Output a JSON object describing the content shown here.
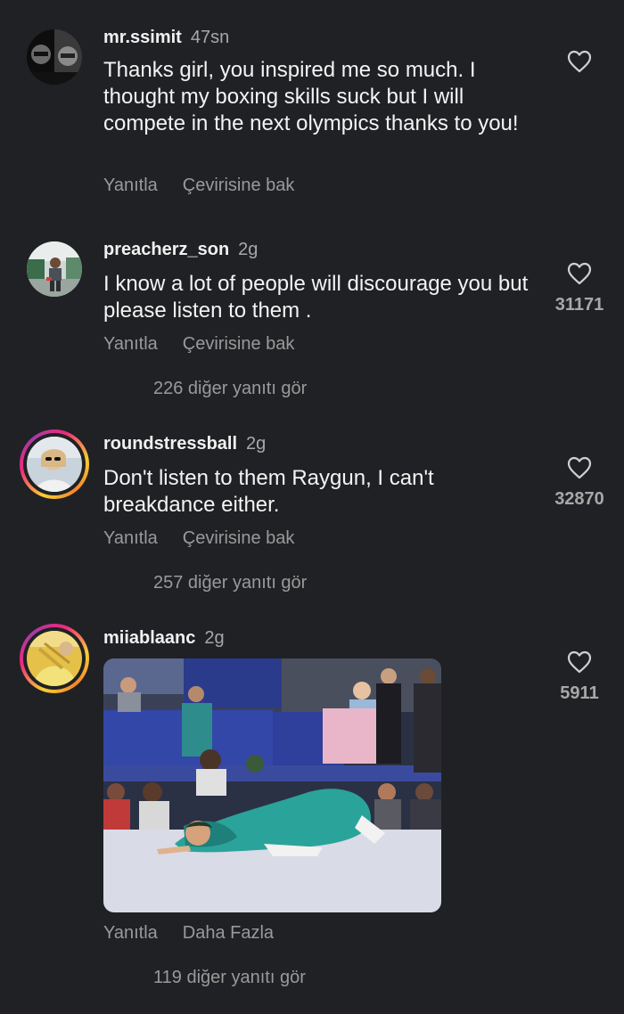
{
  "comments": [
    {
      "username": "mr.ssimit",
      "time": "47sn",
      "text": "Thanks girl, you inspired me so much. I thought my boxing skills suck but I will compete in the next olympics thanks to you!",
      "reply_label": "Yanıtla",
      "translate_label": "Çevirisine bak",
      "like_icon": "heart-outline-icon",
      "like_count": ""
    },
    {
      "username": "preacherz_son",
      "time": "2g",
      "text": "I know a lot of people will discourage you but please listen to them .",
      "reply_label": "Yanıtla",
      "translate_label": "Çevirisine bak",
      "like_icon": "heart-outline-icon",
      "like_count": "31171",
      "view_replies": "226 diğer yanıtı gör"
    },
    {
      "username": "roundstressball",
      "time": "2g",
      "text": "Don't listen to them Raygun, I can't breakdance either.",
      "reply_label": "Yanıtla",
      "translate_label": "Çevirisine bak",
      "like_icon": "heart-outline-icon",
      "like_count": "32870",
      "view_replies": "257 diğer yanıtı gör"
    },
    {
      "username": "miiablaanc",
      "time": "2g",
      "media": "gif-breakdance-olympics",
      "reply_label": "Yanıtla",
      "more_label": "Daha Fazla",
      "like_icon": "heart-outline-icon",
      "like_count": "5911",
      "view_replies": "119 diğer yanıtı gör"
    }
  ],
  "colors": {
    "background": "#202124",
    "primary_text": "#f3f3f3",
    "secondary_text": "#9a9a9a",
    "story_ring": [
      "#f9ce34",
      "#ee2a7b",
      "#a63aa9"
    ]
  }
}
